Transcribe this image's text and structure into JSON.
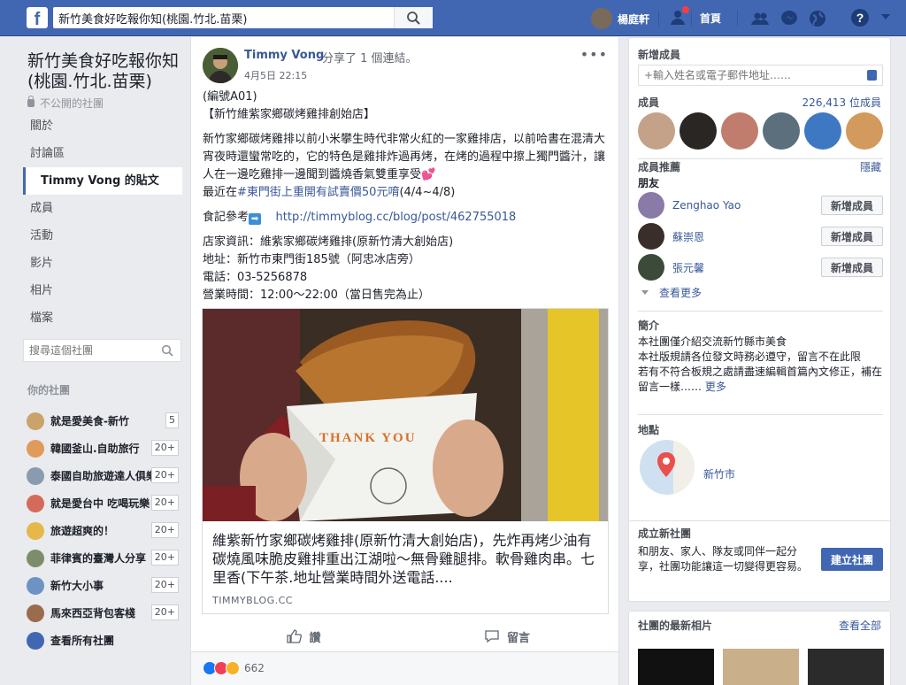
{
  "topbar": {
    "logo": "f",
    "search_value": "新竹美食好吃報你知(桃園.竹北.苗栗)",
    "user_name": "楊庭軒",
    "home": "首頁",
    "help": "?"
  },
  "left": {
    "group_name": "新竹美食好吃報你知(桃園.竹北.苗栗)",
    "privacy": "不公開的社團",
    "nav": [
      "關於",
      "討論區",
      "Timmy Vong 的貼文",
      "成員",
      "活動",
      "影片",
      "相片",
      "檔案"
    ],
    "search_placeholder": "搜尋這個社團",
    "your_groups": "你的社團",
    "groups": [
      {
        "name": "就是愛美食-新竹",
        "count": "5",
        "color": "#c9a36b"
      },
      {
        "name": "韓國釜山.自助旅行",
        "count": "20+",
        "color": "#e09a5b"
      },
      {
        "name": "泰國自助旅遊達人俱樂部",
        "count": "20+",
        "color": "#8a9bb0"
      },
      {
        "name": "就是愛台中 吃喝玩樂",
        "count": "20+",
        "color": "#d46a5a"
      },
      {
        "name": "旅遊超爽的！",
        "count": "20+",
        "color": "#e6b84a"
      },
      {
        "name": "菲律賓的臺灣人分享",
        "count": "20+",
        "color": "#7d8c6a"
      },
      {
        "name": "新竹大小事",
        "count": "20+",
        "color": "#6c93c4"
      },
      {
        "name": "馬來西亞背包客棧",
        "count": "20+",
        "color": "#9a6b4c"
      }
    ],
    "see_all": "查看所有社團"
  },
  "post": {
    "author": "Timmy Vong",
    "action": "分享了 1 個連結。",
    "time": "4月5日 22:15",
    "more": "•••",
    "line_code": "(編號A01)",
    "line_title": "【新竹維紫家鄉碳烤雞排創始店】",
    "desc": "新竹家鄉碳烤雞排以前小米攀生時代非常火紅的一家雞排店，以前哈書在混清大宵夜時還蠻常吃的，它的特色是雞排炸過再烤，在烤的過程中擦上獨門醬汁，讓人在一邊吃雞排一邊聞到醬燒香氣雙重享受",
    "heart": "💕",
    "promo_prefix": "最近在",
    "promo_tag": "#東門街上重開有試賣價50元唷",
    "promo_suffix": "(4/4~4/8)",
    "ref_label": "食記參考",
    "ref_arrow": "➡",
    "ref_url": "http://timmyblog.cc/blog/post/462755018",
    "info_1": "店家資訊：維紫家鄉碳烤雞排(原新竹清大創始店)",
    "info_2": "地址：新竹市東門街185號（阿忠冰店旁）",
    "info_3": "電話：03-5256878",
    "info_4": "營業時間：12:00～22:00（當日售完為止）",
    "card_title": "維紫新竹家鄉碳烤雞排(原新竹清大創始店)，先炸再烤少油有碳燒風味脆皮雞排重出江湖啦～無骨雞腿排。軟骨雞肉串。七里香(下午茶.地址營業時間外送電話....",
    "card_domain": "TIMMYBLOG.CC",
    "card_image_text": "THANK YOU",
    "like": "讚",
    "comment": "留言",
    "reaction_count": "662"
  },
  "right": {
    "add_members_title": "新增成員",
    "add_placeholder": "+輸入姓名或電子郵件地址……",
    "members_label": "成員",
    "members_count": "226,413 位成員",
    "suggested_title": "成員推薦",
    "hide": "隱藏",
    "friends": "朋友",
    "suggestions": [
      {
        "name": "Zenghao Yao",
        "color": "#8a7aa8"
      },
      {
        "name": "蘇崇恩",
        "color": "#3a2e2a"
      },
      {
        "name": "張元馨",
        "color": "#3c4a3a"
      }
    ],
    "add_button": "新增成員",
    "see_more": "查看更多",
    "intro_title": "簡介",
    "intro_text": "本社團僅介紹交流新竹縣市美食\n本社版規請各位發文時務必遵守，留言不在此限\n若有不符合板規之處請盡速編輯首篇內文修正，補在留言一樣……",
    "intro_more": "更多",
    "location_title": "地點",
    "location_name": "新竹市",
    "create_title": "成立新社團",
    "create_text": "和朋友、家人、隊友或同伴一起分享，社團功能讓這一切變得更容易。",
    "create_button": "建立社團",
    "photos_title": "社團的最新相片",
    "photos_all": "查看全部"
  },
  "colors": {
    "brand": "#4267b2",
    "link": "#385898",
    "background": "#e9ebee"
  }
}
